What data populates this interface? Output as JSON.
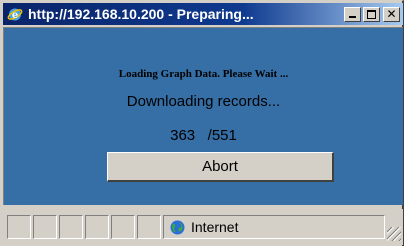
{
  "window": {
    "title": "http://192.168.10.200 - Preparing...",
    "title_icon": "internet-explorer-icon",
    "controls": {
      "minimize": "minimize-icon",
      "maximize": "maximize-icon",
      "close_glyph": "✕"
    }
  },
  "dialog": {
    "loading_text": "Loading Graph Data. Please Wait ...",
    "status_text": "Downloading records...",
    "progress": {
      "current": "363",
      "separator": "/551",
      "current_value": 363,
      "total_value": 551
    },
    "abort_label": "Abort"
  },
  "statusbar": {
    "zone_label": "Internet",
    "zone_icon": "globe-icon"
  },
  "colors": {
    "titlebar": "#0a246a",
    "content_background": "#366fa6",
    "window_face": "#d4d0c8"
  }
}
